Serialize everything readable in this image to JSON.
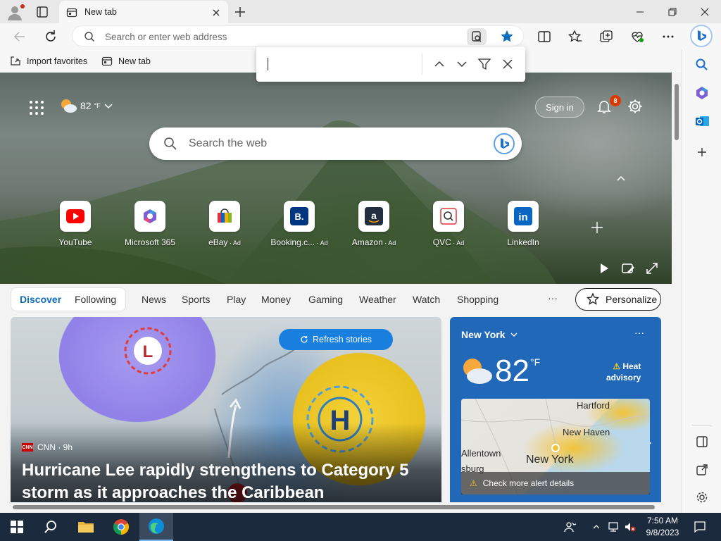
{
  "window": {
    "tab_title": "New tab"
  },
  "address_bar": {
    "placeholder": "Search or enter web address"
  },
  "favorites_bar": {
    "items": [
      {
        "label": "Import favorites"
      },
      {
        "label": "New tab"
      }
    ]
  },
  "find_bar": {
    "value": ""
  },
  "hero": {
    "weather_temp": "82",
    "weather_unit": "°F",
    "signin_label": "Sign in",
    "notifications_count": "8",
    "search_placeholder": "Search the web"
  },
  "quick_links": [
    {
      "label": "YouTube",
      "ad": ""
    },
    {
      "label": "Microsoft 365",
      "ad": ""
    },
    {
      "label": "eBay",
      "ad": " · Ad"
    },
    {
      "label": "Booking.c...",
      "ad": " · Ad"
    },
    {
      "label": "Amazon",
      "ad": " · Ad"
    },
    {
      "label": "QVC",
      "ad": " · Ad"
    },
    {
      "label": "LinkedIn",
      "ad": ""
    }
  ],
  "feed_nav": {
    "tabs": [
      "Discover",
      "Following",
      "News",
      "Sports",
      "Play",
      "Money",
      "Gaming",
      "Weather",
      "Watch",
      "Shopping"
    ],
    "more": "···",
    "personalize_label": "Personalize"
  },
  "news_card": {
    "refresh_label": "Refresh stories",
    "source": "CNN · 9h",
    "source_logo": "CNN",
    "headline": "Hurricane Lee rapidly strengthens to Category 5 storm as it approaches the Caribbean"
  },
  "weather_card": {
    "location": "New York",
    "more": "···",
    "temp": "82",
    "unit": "°F",
    "alert_line1": "Heat",
    "alert_line2": "advisory",
    "map_cities": [
      "Hartford",
      "New Haven",
      "Allentown",
      "New York",
      "sburg"
    ],
    "alert_details": "Check more alert details"
  },
  "taskbar": {
    "time": "7:50 AM",
    "date": "9/8/2023"
  },
  "colors": {
    "accent": "#0f6cbd",
    "notification_badge": "#d83b01",
    "weather_card_bg": "#2169b8"
  }
}
